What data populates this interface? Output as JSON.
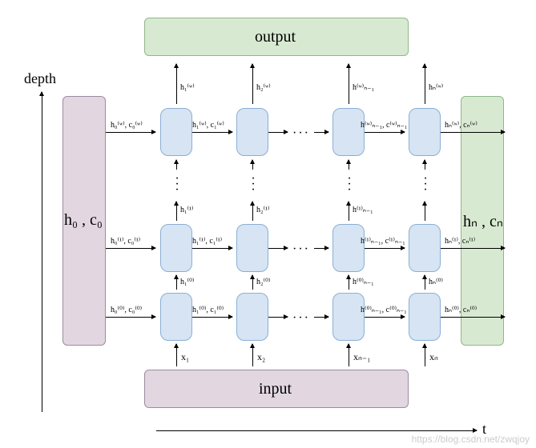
{
  "axes": {
    "depth_label": "depth",
    "time_label": "t"
  },
  "boxes": {
    "output": "output",
    "input": "input",
    "init_state": "h₀ , c₀",
    "final_state": "hₙ , cₙ"
  },
  "row_top": {
    "h_init": "h₀⁽ʷ⁾, c₀⁽ʷ⁾",
    "h_1": "h₁⁽ʷ⁾, c₁⁽ʷ⁾",
    "h_nm1": "h⁽ʷ⁾ₙ₋₁, c⁽ʷ⁾ₙ₋₁",
    "h_n": "hₙ⁽ʷ⁾, cₙ⁽ʷ⁾",
    "v_1": "h₁⁽ʷ⁾",
    "v_2": "h₂⁽ʷ⁾",
    "v_nm1": "h⁽ʷ⁾ₙ₋₁",
    "v_n": "hₙ⁽ʷ⁾"
  },
  "row_mid": {
    "h_init": "h₀⁽¹⁾, c₀⁽¹⁾",
    "h_1": "h₁⁽¹⁾, c₁⁽¹⁾",
    "h_nm1": "h⁽¹⁾ₙ₋₁, c⁽¹⁾ₙ₋₁",
    "h_n": "hₙ⁽¹⁾, cₙ⁽¹⁾",
    "v_1": "h₁⁽¹⁾",
    "v_2": "h₂⁽¹⁾",
    "v_nm1": "h⁽¹⁾ₙ₋₁"
  },
  "row_bot": {
    "h_init": "h₀⁽⁰⁾, c₀⁽⁰⁾",
    "h_1": "h₁⁽⁰⁾, c₁⁽⁰⁾",
    "h_nm1": "h⁽⁰⁾ₙ₋₁, c⁽⁰⁾ₙ₋₁",
    "h_n": "hₙ⁽⁰⁾, cₙ⁽⁰⁾",
    "v_1": "h₁⁽⁰⁾",
    "v_2": "h₂⁽⁰⁾",
    "v_nm1": "h⁽⁰⁾ₙ₋₁",
    "v_n": "hₙ⁽⁰⁾"
  },
  "inputs": {
    "x_1": "x₁",
    "x_2": "x₂",
    "x_nm1": "xₙ₋₁",
    "x_n": "xₙ"
  },
  "watermark": "https://blog.csdn.net/zwqjoy",
  "chart_data": {
    "type": "diagram",
    "description": "Stacked RNN unrolled over time",
    "depth_layers": [
      "0",
      "1",
      "...",
      "w"
    ],
    "time_steps": [
      "1",
      "2",
      "...",
      "n-1",
      "n"
    ],
    "initial_state": "h0, c0",
    "final_state": "hn, cn",
    "inputs": [
      "x_1",
      "x_2",
      "...",
      "x_{n-1}",
      "x_n"
    ],
    "outputs_from_top_layer": [
      "h_1^(w)",
      "h_2^(w)",
      "...",
      "h_{n-1}^(w)",
      "h_n^(w)"
    ],
    "horizontal_edge_label_pattern": "h_t^(l), c_t^(l)",
    "vertical_edge_label_pattern": "h_t^(l)"
  }
}
